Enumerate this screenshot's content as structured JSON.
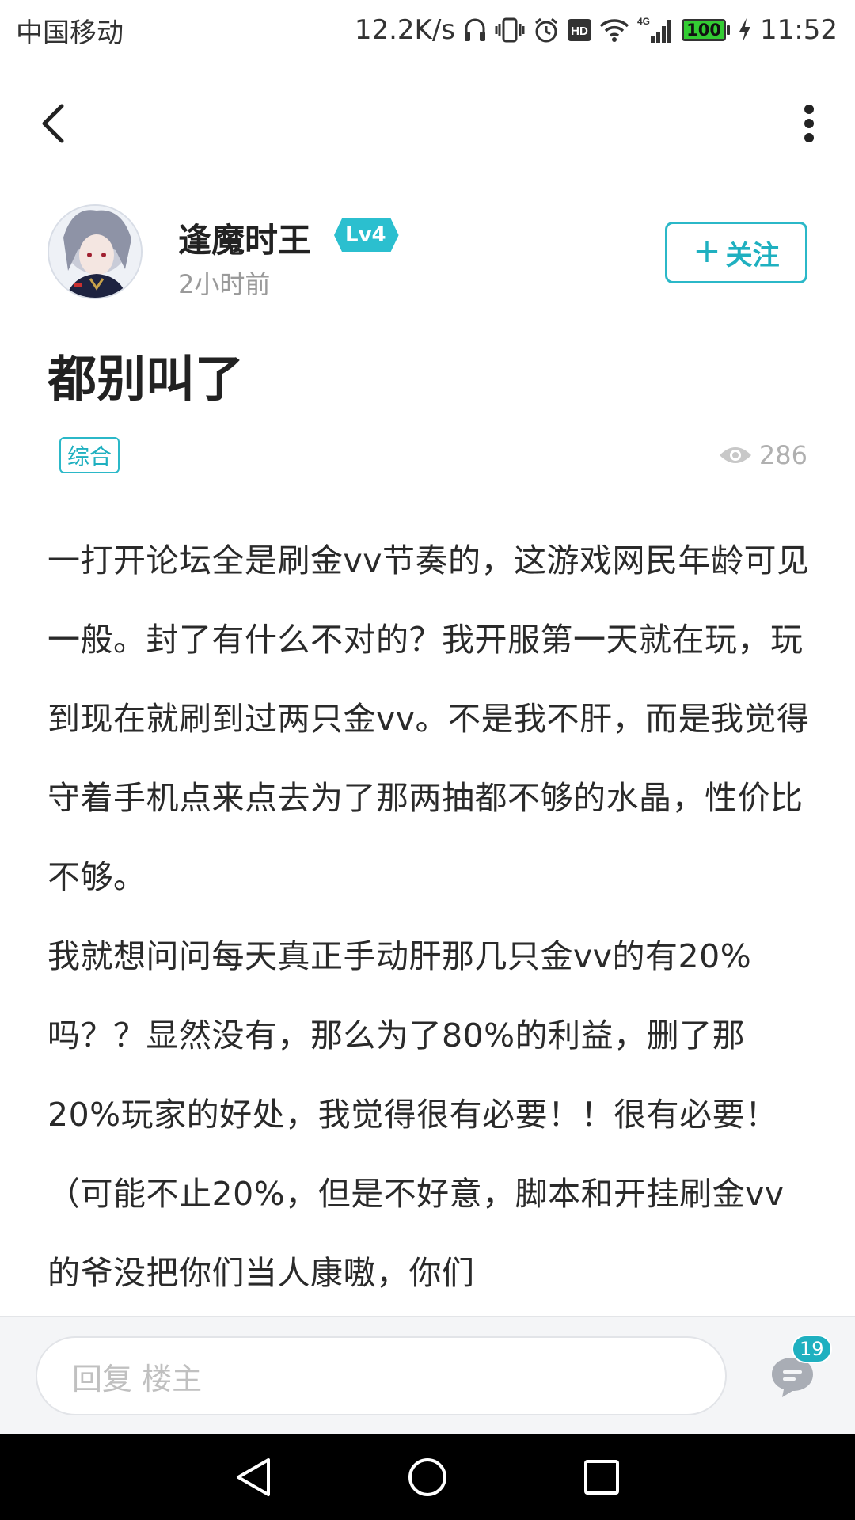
{
  "status_bar": {
    "carrier": "中国移动",
    "net_speed": "12.2K/s",
    "network_type": "4G",
    "battery": "100",
    "battery_level": 1.0,
    "time": "11:52",
    "icons": [
      "headphones-icon",
      "vibrate-icon",
      "alarm-icon",
      "hd-icon",
      "wifi-icon",
      "signal-icon",
      "charging-icon"
    ]
  },
  "nav": {
    "back_icon": "chevron-left-icon",
    "more_icon": "more-vertical-icon"
  },
  "author": {
    "name": "逢魔时王",
    "level": "Lv4",
    "time_ago": "2小时前",
    "follow_label": "关注",
    "follow_plus": "+"
  },
  "post": {
    "title": "都别叫了",
    "tag": "综合",
    "views": "286",
    "paragraphs": [
      "一打开论坛全是刷金vv节奏的，这游戏网民年龄可见一般。封了有什么不对的？我开服第一天就在玩，玩到现在就刷到过两只金vv。不是我不肝，而是我觉得守着手机点来点去为了那两抽都不够的水晶，性价比不够。",
      "我就想问问每天真正手动肝那几只金vv的有20%吗？？显然没有，那么为了80%的利益，删了那20%玩家的好处，我觉得很有必要！！很有必要！（可能不止20%，但是不好意，脚本和开挂刷金vv的爷没把你们当人康嗷，你们"
    ]
  },
  "reply": {
    "placeholder": "回复  楼主",
    "comment_count": "19"
  },
  "colors": {
    "accent": "#1fb0c0",
    "level_badge": "#2bbfcf",
    "muted": "#9a9a9a",
    "battery_fill": "#33cc33"
  }
}
